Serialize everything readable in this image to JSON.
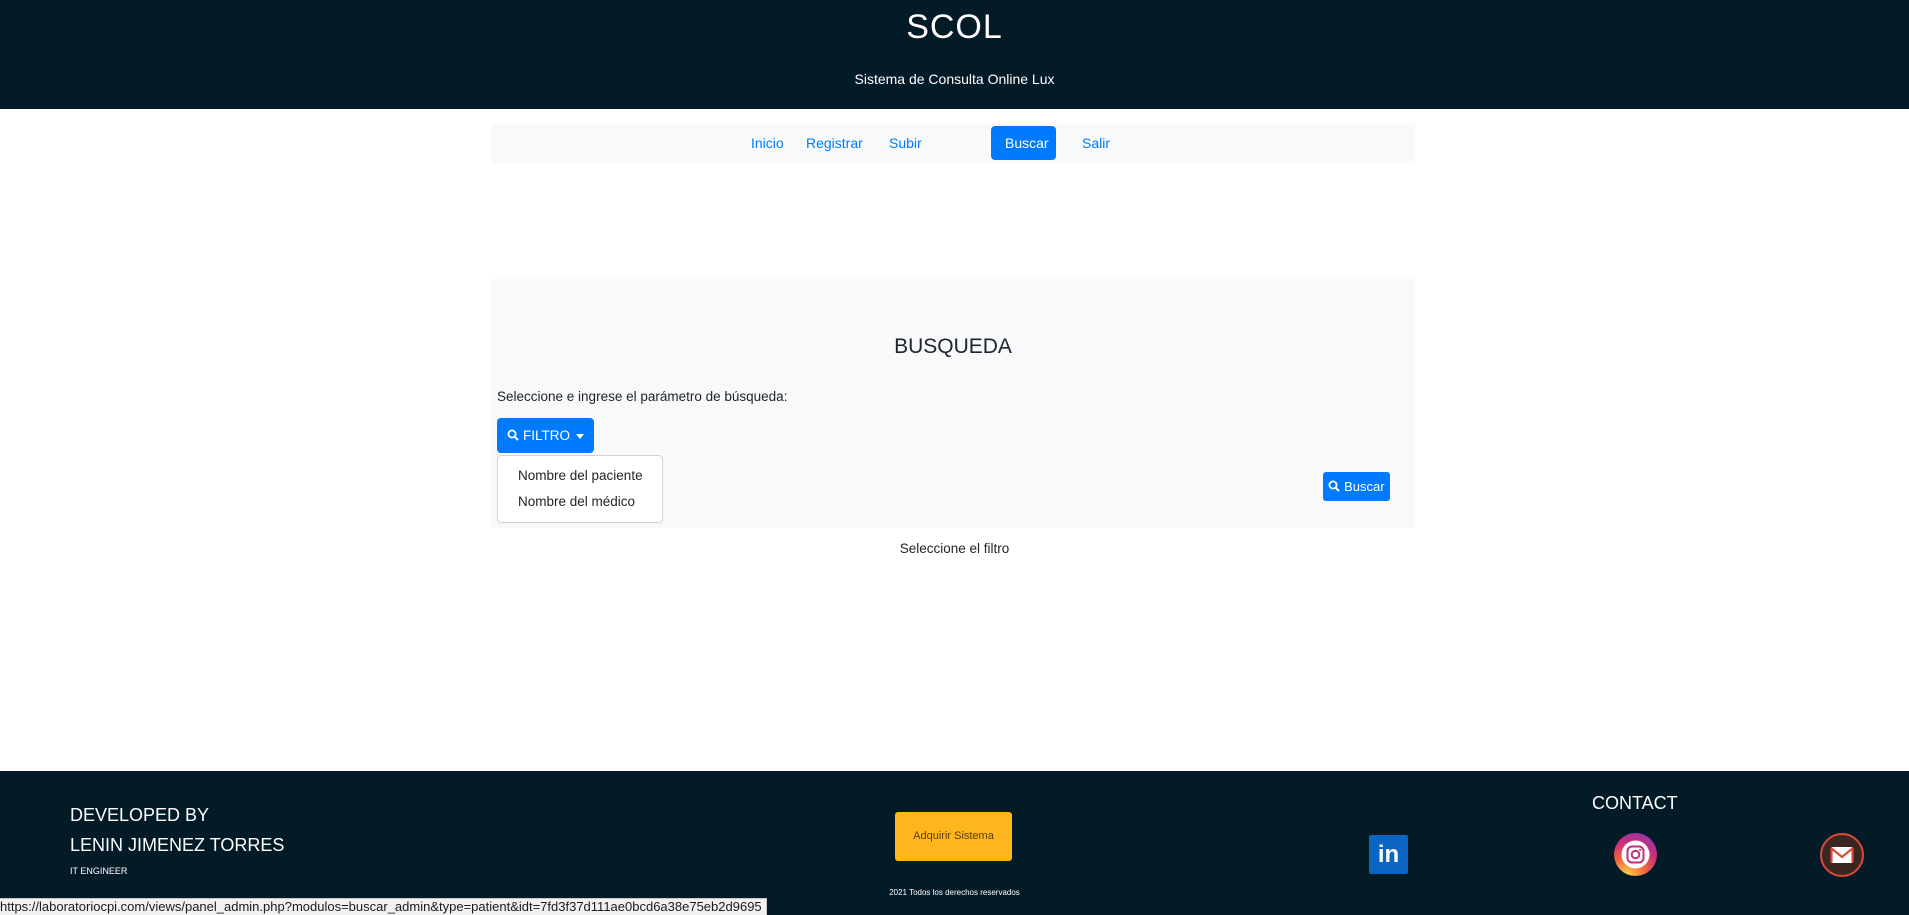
{
  "header": {
    "title": "SCOL",
    "subtitle": "Sistema de Consulta Online Lux"
  },
  "nav": {
    "items": [
      {
        "label": "Inicio",
        "active": false
      },
      {
        "label": "Registrar",
        "active": false
      },
      {
        "label": "Subir",
        "active": false
      },
      {
        "label": "Buscar",
        "active": true
      },
      {
        "label": "Salir",
        "active": false
      }
    ]
  },
  "search_panel": {
    "title": "BUSQUEDA",
    "instruction": "Seleccione e ingrese el parámetro de búsqueda:",
    "filter_button_label": "FILTRO",
    "filter_options": [
      "Nombre del paciente",
      "Nombre del médico"
    ],
    "search_button_label": "Buscar",
    "status_message": "Seleccione el filtro"
  },
  "footer": {
    "developed_by": "DEVELOPED BY",
    "developer_name": "LENIN JIMENEZ TORRES",
    "developer_role": "IT ENGINEER",
    "acquire_button": "Adquirir Sistema",
    "copyright": "2021 Todos los derechos reservados",
    "contact_label": "CONTACT",
    "contact_icons": [
      "linkedin-icon",
      "instagram-icon",
      "mail-icon"
    ]
  },
  "status_bar": {
    "url": "https://laboratoriocpi.com/views/panel_admin.php?modulos=buscar_admin&type=patient&idt=7fd3f37d111ae0bcd6a38e75eb2d9695"
  },
  "colors": {
    "header_bg": "#031a27",
    "primary": "#007bff",
    "panel_bg": "#f8f9fa",
    "accent_yellow": "#ffb51e"
  }
}
